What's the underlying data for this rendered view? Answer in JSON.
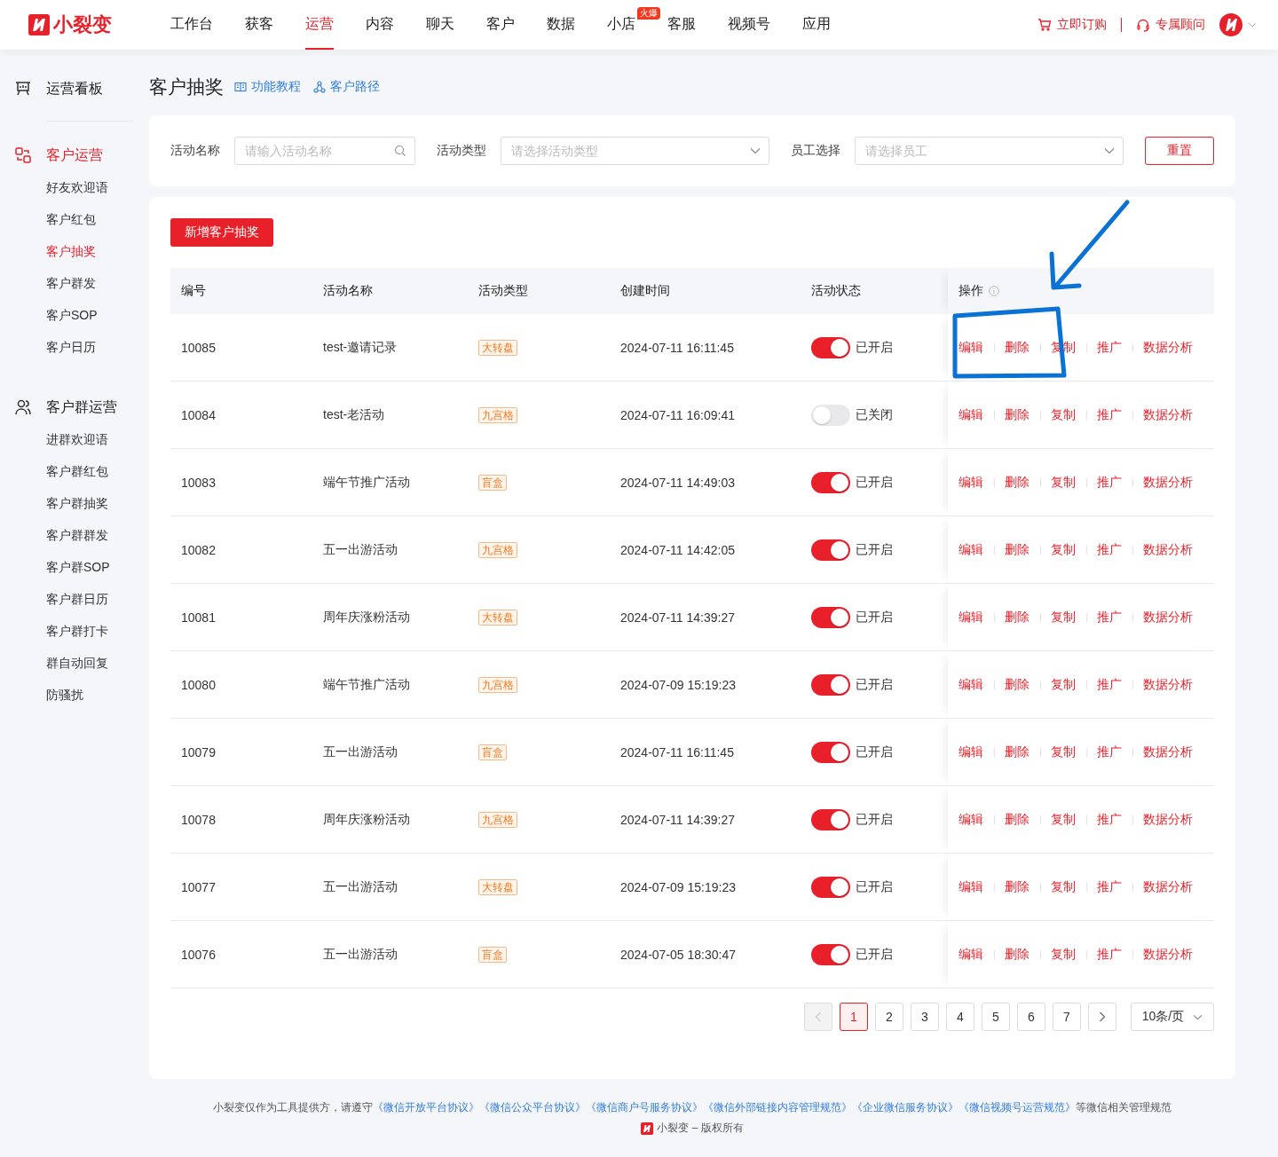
{
  "header": {
    "brand": "小裂变",
    "nav": [
      {
        "label": "工作台",
        "selected": false
      },
      {
        "label": "获客",
        "selected": false
      },
      {
        "label": "运营",
        "selected": true
      },
      {
        "label": "内容",
        "selected": false
      },
      {
        "label": "聊天",
        "selected": false
      },
      {
        "label": "客户",
        "selected": false
      },
      {
        "label": "数据",
        "selected": false
      },
      {
        "label": "小店",
        "selected": false,
        "badge": "火爆"
      },
      {
        "label": "客服",
        "selected": false
      },
      {
        "label": "视频号",
        "selected": false
      },
      {
        "label": "应用",
        "selected": false
      }
    ],
    "actions": [
      {
        "kind": "cart",
        "label": "立即订购"
      },
      {
        "kind": "headset",
        "label": "专属顾问"
      }
    ]
  },
  "sidebar": {
    "groups": [
      {
        "kind": "board",
        "title": "运营看板",
        "selected": false
      },
      {
        "kind": "customers",
        "title": "客户运营",
        "selected": true,
        "items": [
          {
            "label": "好友欢迎语",
            "selected": false
          },
          {
            "label": "客户红包",
            "selected": false
          },
          {
            "label": "客户抽奖",
            "selected": true
          },
          {
            "label": "客户群发",
            "selected": false
          },
          {
            "label": "客户SOP",
            "selected": false
          },
          {
            "label": "客户日历",
            "selected": false
          }
        ]
      },
      {
        "kind": "groups",
        "title": "客户群运营",
        "selected": false,
        "items": [
          {
            "label": "进群欢迎语",
            "selected": false
          },
          {
            "label": "客户群红包",
            "selected": false
          },
          {
            "label": "客户群抽奖",
            "selected": false
          },
          {
            "label": "客户群群发",
            "selected": false
          },
          {
            "label": "客户群SOP",
            "selected": false
          },
          {
            "label": "客户群日历",
            "selected": false
          },
          {
            "label": "客户群打卡",
            "selected": false
          },
          {
            "label": "群自动回复",
            "selected": false
          },
          {
            "label": "防骚扰",
            "selected": false
          }
        ]
      }
    ]
  },
  "page": {
    "title": "客户抽奖",
    "links": [
      {
        "kind": "book",
        "label": "功能教程"
      },
      {
        "kind": "path",
        "label": "客户路径"
      }
    ]
  },
  "filters": {
    "fields": [
      {
        "kind": "search",
        "label": "活动名称",
        "placeholder": "请输入活动名称"
      },
      {
        "kind": "select",
        "label": "活动类型",
        "placeholder": "请选择活动类型"
      },
      {
        "kind": "select",
        "label": "员工选择",
        "placeholder": "请选择员工"
      }
    ],
    "reset": "重置"
  },
  "table": {
    "add_button": "新增客户抽奖",
    "columns": [
      "编号",
      "活动名称",
      "活动类型",
      "创建时间",
      "活动状态",
      "操作"
    ],
    "rows": [
      {
        "id": "10085",
        "name": "test-邀请记录",
        "type": "大转盘",
        "created": "2024-07-11 16:11:45",
        "enabled": true,
        "status": "已开启",
        "actions": [
          "编辑",
          "删除",
          "复制",
          "推广",
          "数据分析"
        ]
      },
      {
        "id": "10084",
        "name": "test-老活动",
        "type": "九宫格",
        "created": "2024-07-11 16:09:41",
        "enabled": false,
        "status": "已关闭",
        "actions": [
          "编辑",
          "删除",
          "复制",
          "推广",
          "数据分析"
        ]
      },
      {
        "id": "10083",
        "name": "端午节推广活动",
        "type": "盲盒",
        "created": "2024-07-11 14:49:03",
        "enabled": true,
        "status": "已开启",
        "actions": [
          "编辑",
          "删除",
          "复制",
          "推广",
          "数据分析"
        ]
      },
      {
        "id": "10082",
        "name": "五一出游活动",
        "type": "九宫格",
        "created": "2024-07-11 14:42:05",
        "enabled": true,
        "status": "已开启",
        "actions": [
          "编辑",
          "删除",
          "复制",
          "推广",
          "数据分析"
        ]
      },
      {
        "id": "10081",
        "name": "周年庆涨粉活动",
        "type": "大转盘",
        "created": "2024-07-11 14:39:27",
        "enabled": true,
        "status": "已开启",
        "actions": [
          "编辑",
          "删除",
          "复制",
          "推广",
          "数据分析"
        ]
      },
      {
        "id": "10080",
        "name": "端午节推广活动",
        "type": "九宫格",
        "created": "2024-07-09 15:19:23",
        "enabled": true,
        "status": "已开启",
        "actions": [
          "编辑",
          "删除",
          "复制",
          "推广",
          "数据分析"
        ]
      },
      {
        "id": "10079",
        "name": "五一出游活动",
        "type": "盲盒",
        "created": "2024-07-11 16:11:45",
        "enabled": true,
        "status": "已开启",
        "actions": [
          "编辑",
          "删除",
          "复制",
          "推广",
          "数据分析"
        ]
      },
      {
        "id": "10078",
        "name": "周年庆涨粉活动",
        "type": "九宫格",
        "created": "2024-07-11 14:39:27",
        "enabled": true,
        "status": "已开启",
        "actions": [
          "编辑",
          "删除",
          "复制",
          "推广",
          "数据分析"
        ]
      },
      {
        "id": "10077",
        "name": "五一出游活动",
        "type": "大转盘",
        "created": "2024-07-09 15:19:23",
        "enabled": true,
        "status": "已开启",
        "actions": [
          "编辑",
          "删除",
          "复制",
          "推广",
          "数据分析"
        ]
      },
      {
        "id": "10076",
        "name": "五一出游活动",
        "type": "盲盒",
        "created": "2024-07-05 18:30:47",
        "enabled": true,
        "status": "已开启",
        "actions": [
          "编辑",
          "删除",
          "复制",
          "推广",
          "数据分析"
        ]
      }
    ]
  },
  "pagination": {
    "pages": [
      {
        "label": "1",
        "selected": true
      },
      {
        "label": "2",
        "selected": false
      },
      {
        "label": "3",
        "selected": false
      },
      {
        "label": "4",
        "selected": false
      },
      {
        "label": "5",
        "selected": false
      },
      {
        "label": "6",
        "selected": false
      },
      {
        "label": "7",
        "selected": false
      }
    ],
    "prev_disabled": true,
    "page_size": "10条/页"
  },
  "annotation": {
    "arrow": true,
    "highlight_box": true
  },
  "footer": {
    "prefix": "小裂变仅作为工具提供方，请遵守",
    "links": [
      "《微信开放平台协议》",
      "《微信公众平台协议》",
      "《微信商户号服务协议》",
      "《微信外部链接内容管理规范》",
      "《企业微信服务协议》",
      "《微信视频号运营规范》"
    ],
    "suffix": "等微信相关管理规范",
    "copyright": "小裂变 – 版权所有"
  }
}
